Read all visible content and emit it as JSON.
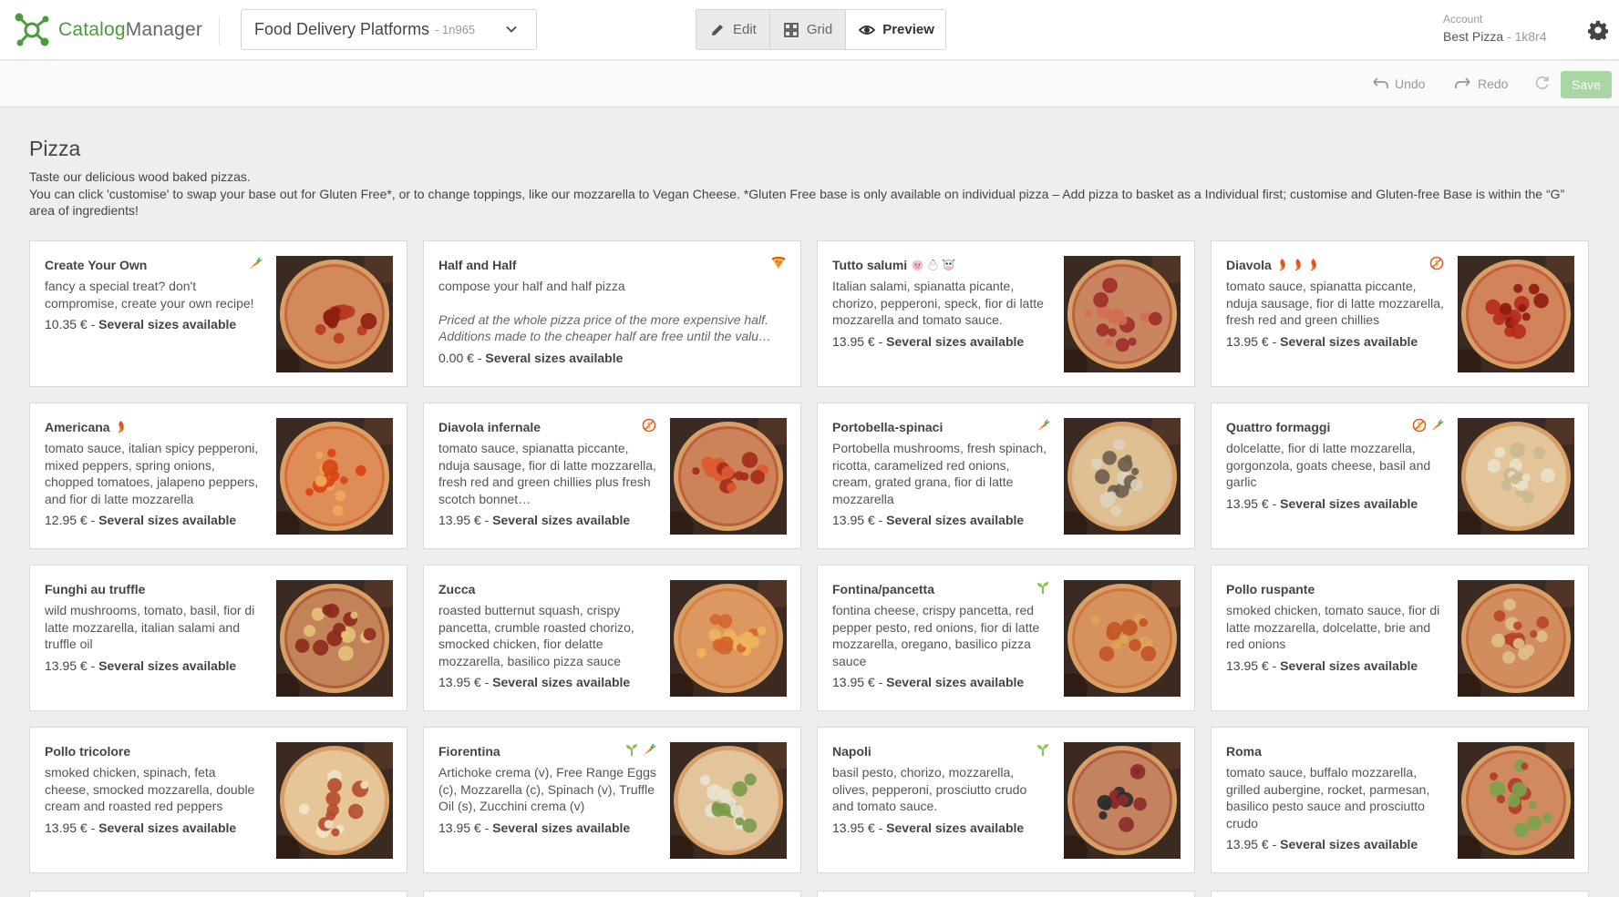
{
  "app": {
    "logo_part1": "Catalog",
    "logo_part2": "Manager"
  },
  "platform": {
    "name": "Food Delivery Platforms",
    "code": "- 1n965"
  },
  "modes": {
    "edit": "Edit",
    "grid": "Grid",
    "preview": "Preview"
  },
  "account": {
    "label": "Account",
    "name": "Best Pizza",
    "code": "- 1k8r4"
  },
  "actions": {
    "undo": "Undo",
    "redo": "Redo",
    "save": "Save"
  },
  "colors": {
    "brand_green": "#4b9a3d",
    "save_disabled": "#a9d7a3",
    "chili": "#e8541e",
    "veg": "#6aa84f"
  },
  "section": {
    "title": "Pizza",
    "desc1": "Taste our delicious wood baked pizzas.",
    "desc2": "You can click 'customise' to swap your base out for Gluten Free*, or to change toppings, like our mozzarella to Vegan Cheese. *Gluten Free base is only available on individual pizza – Add pizza to basket as a Individual first; customise and Gluten-free Base is within the “G” area of ingredients!"
  },
  "separator": "-",
  "products": [
    {
      "name": "Create Your Own",
      "desc": "fancy a special treat? don't compromise, create your own recipe!",
      "price": "10.35 €",
      "sizes": "Several sizes available",
      "icons": [
        "carrot-icon"
      ]
    },
    {
      "name": "Half and Half",
      "desc": "compose your half and half pizza",
      "note1": "Priced at the whole pizza price of the more expensive half.",
      "note2": "Additions made to the cheaper half are free until the valu…",
      "price": "0.00 €",
      "sizes": "Several sizes available",
      "icons": [
        "pizza-slice-icon"
      ]
    },
    {
      "name": "Tutto salumi",
      "desc": "Italian salami, spianatta picante, chorizo, pepperoni, speck, fior di latte mozzarella and tomato sauce.",
      "price": "13.95 €",
      "sizes": "Several sizes available",
      "inline_icons": [
        "pig-icon",
        "chicken-icon",
        "cow-icon"
      ]
    },
    {
      "name": "Diavola",
      "desc": "tomato sauce, spianatta piccante, nduja sausage, fior di latte mozzarella, fresh red and green chillies",
      "price": "13.95 €",
      "sizes": "Several sizes available",
      "inline_icons": [
        "chili-icon",
        "chili-icon",
        "chili-icon"
      ],
      "icons": [
        "no-gluten-icon"
      ]
    },
    {
      "name": "Americana",
      "desc": "tomato sauce, italian spicy pepperoni, mixed peppers, spring onions, chopped tomatoes, jalapeno peppers, and fior di latte mozzarella",
      "price": "12.95 €",
      "sizes": "Several sizes available",
      "inline_icons": [
        "chili-icon"
      ]
    },
    {
      "name": "Diavola infernale",
      "desc": "tomato sauce, spianatta piccante, nduja sausage, fior di latte mozzarella, fresh red and green chillies plus fresh scotch bonnet…",
      "price": "13.95 €",
      "sizes": "Several sizes available",
      "icons": [
        "no-gluten-icon"
      ]
    },
    {
      "name": "Portobella-spinaci",
      "desc": "Portobella mushrooms, fresh spinach, ricotta, caramelized red onions, cream, grated grana, fior di latte mozzarella",
      "price": "13.95 €",
      "sizes": "Several sizes available",
      "icons": [
        "carrot-icon"
      ]
    },
    {
      "name": "Quattro formaggi",
      "desc": "dolcelatte, fior di latte mozzarella, gorgonzola, goats cheese, basil and garlic",
      "price": "13.95 €",
      "sizes": "Several sizes available",
      "icons": [
        "no-gluten-icon",
        "carrot-icon"
      ]
    },
    {
      "name": "Funghi au truffle",
      "desc": "wild mushrooms, tomato, basil, fior di latte mozzarella, italian salami and truffle oil",
      "price": "13.95 €",
      "sizes": "Several sizes available"
    },
    {
      "name": "Zucca",
      "desc": "roasted butternut squash, crispy pancetta, crumble roasted chorizo, smocked chicken, fior delatte mozzarella, basilico pizza sauce",
      "price": "13.95 €",
      "sizes": "Several sizes available"
    },
    {
      "name": "Fontina/pancetta",
      "desc": "fontina cheese, crispy pancetta, red pepper pesto, red onions, fior di latte mozzarella, oregano, basilico pizza sauce",
      "price": "13.95 €",
      "sizes": "Several sizes available",
      "icons": [
        "sprout-icon"
      ]
    },
    {
      "name": "Pollo ruspante",
      "desc": "smoked chicken, tomato sauce, fior di latte mozzarella, dolcelatte, brie and red onions",
      "price": "13.95 €",
      "sizes": "Several sizes available"
    },
    {
      "name": "Pollo tricolore",
      "desc": "smoked chicken, spinach, feta cheese, smocked mozzarella, double cream and roasted red peppers",
      "price": "13.95 €",
      "sizes": "Several sizes available"
    },
    {
      "name": "Fiorentina",
      "desc": "Artichoke crema (v), Free Range Eggs (c), Mozzarella (c), Spinach (v), Truffle Oil (s), Zucchini crema (v)",
      "price": "13.95 €",
      "sizes": "Several sizes available",
      "icons": [
        "sprout-icon",
        "carrot-icon"
      ]
    },
    {
      "name": "Napoli",
      "desc": "basil pesto, chorizo, mozzarella, olives, pepperoni, prosciutto crudo and tomato sauce.",
      "price": "13.95 €",
      "sizes": "Several sizes available",
      "icons": [
        "sprout-icon"
      ]
    },
    {
      "name": "Roma",
      "desc": "tomato sauce, buffalo mozzarella, grilled aubergine, rocket, parmesan, basilico pesto sauce and prosciutto crudo",
      "price": "13.95 €",
      "sizes": "Several sizes available"
    }
  ]
}
